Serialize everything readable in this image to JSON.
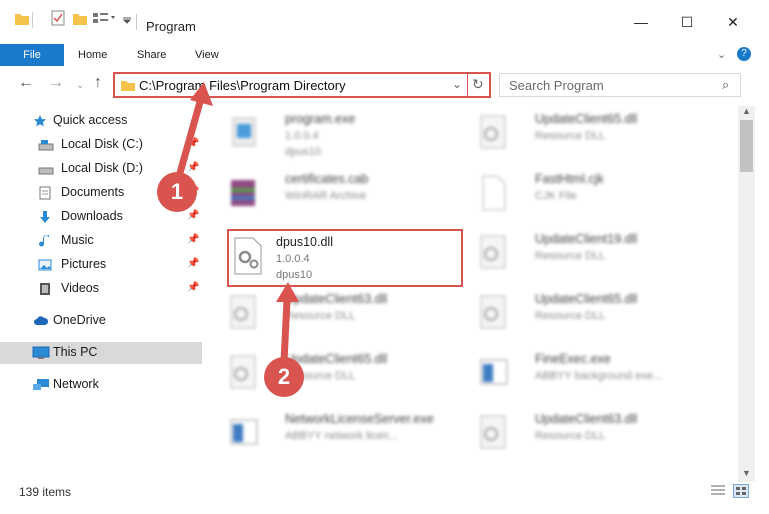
{
  "window": {
    "title": "Program",
    "minimize": "—",
    "maximize": "☐",
    "close": "✕"
  },
  "ribbon": {
    "file": "File",
    "home": "Home",
    "share": "Share",
    "view": "View"
  },
  "address": {
    "path": "C:\\Program Files\\Program Directory",
    "search_placeholder": "Search Program"
  },
  "sidebar": [
    {
      "label": "Quick access"
    },
    {
      "label": "Local Disk (C:)"
    },
    {
      "label": "Local Disk (D:)"
    },
    {
      "label": "Documents"
    },
    {
      "label": "Downloads"
    },
    {
      "label": "Music"
    },
    {
      "label": "Pictures"
    },
    {
      "label": "Videos"
    },
    {
      "label": "OneDrive"
    },
    {
      "label": "This PC"
    },
    {
      "label": "Network"
    }
  ],
  "files": [
    {
      "name": "program.exe",
      "type": "1.0.0.4",
      "desc": "dpus10"
    },
    {
      "name": "UpdateClient65.dll",
      "type": "Resource DLL",
      "desc": ""
    },
    {
      "name": "certificates.cab",
      "type": "WinRAR Archive",
      "desc": ""
    },
    {
      "name": "FastHtml.cjk",
      "type": "CJK File",
      "desc": ""
    },
    {
      "name": "dpus10.dll",
      "type": "1.0.0.4",
      "desc": "dpus10"
    },
    {
      "name": "UpdateClient19.dll",
      "type": "Resource DLL",
      "desc": ""
    },
    {
      "name": "UpdateClient63.dll",
      "type": "Resource DLL",
      "desc": ""
    },
    {
      "name": "UpdateClient65.dll",
      "type": "Resource DLL",
      "desc": ""
    },
    {
      "name": "UpdateClient65.dll",
      "type": "Resource DLL",
      "desc": ""
    },
    {
      "name": "FineExec.exe",
      "type": "ABBYY background exe...",
      "desc": ""
    },
    {
      "name": "NetworkLicenseServer.exe",
      "type": "ABBYY network licen...",
      "desc": ""
    },
    {
      "name": "UpdateClient63.dll",
      "type": "Resource DLL",
      "desc": ""
    }
  ],
  "annotations": {
    "step1": "1",
    "step2": "2"
  },
  "status": {
    "count": "139 items"
  },
  "colors": {
    "accent": "#1979ca",
    "highlight": "#d9534f"
  }
}
